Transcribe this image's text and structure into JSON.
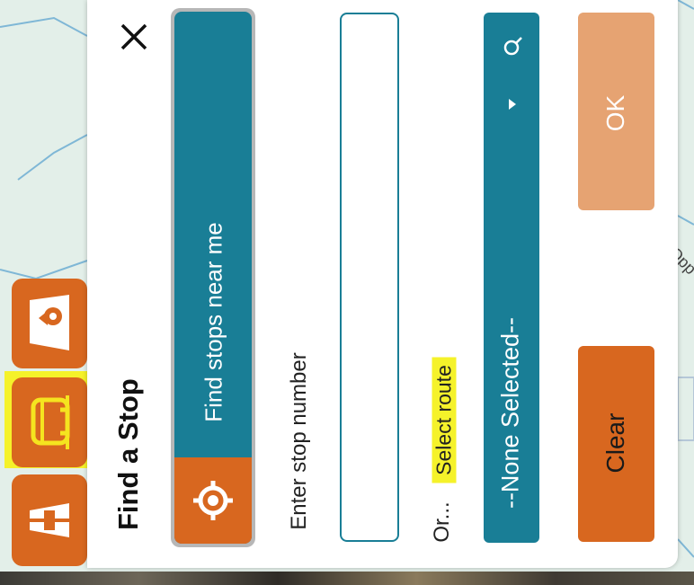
{
  "dialog": {
    "title": "Find a Stop",
    "find_near_label": "Find stops near me",
    "stop_number_label": "Enter stop number",
    "stop_number_value": "",
    "or_label": "Or...",
    "select_route_label": "Select route",
    "route_selected": "--None Selected--",
    "ok_label": "OK",
    "clear_label": "Clear"
  },
  "map": {
    "road_label": "Opp"
  },
  "side_buttons": [
    {
      "icon": "road-icon"
    },
    {
      "icon": "bus-stop-icon"
    },
    {
      "icon": "map-pin-icon"
    }
  ],
  "colors": {
    "accent_teal": "#197e96",
    "accent_orange": "#d8671f",
    "ok_disabled": "#e6a372",
    "highlight": "#f5f22a"
  }
}
